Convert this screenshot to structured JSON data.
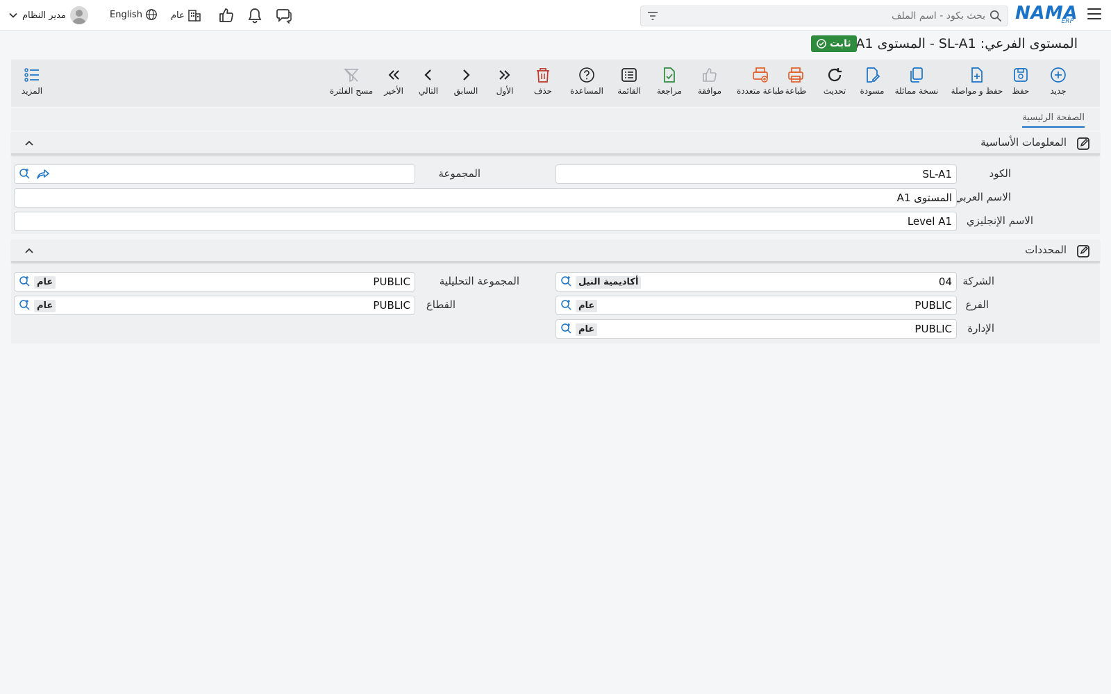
{
  "header": {
    "logo_text": "NAMA",
    "logo_sub": "ERP",
    "search_placeholder": "بحث بكود - اسم الملف",
    "language": "English",
    "branch": "عام",
    "user": "مدير النظام"
  },
  "page": {
    "title": "المستوى الفرعي: SL-A1 - المستوى A1",
    "status_badge": "ثابت"
  },
  "toolbar": {
    "new": "جديد",
    "save": "حفظ",
    "save_continue": "حفظ و مواصلة",
    "duplicate": "نسخة مماثلة",
    "draft": "مسودة",
    "refresh": "تحديث",
    "print": "طباعة",
    "multi_print": "طباعة متعددة",
    "approve": "موافقة",
    "review": "مراجعة",
    "list": "القائمة",
    "help": "المساعدة",
    "delete": "حذف",
    "first": "الأول",
    "previous": "السابق",
    "next": "التالي",
    "last": "الأخير",
    "clear_filter": "مسح الفلترة",
    "more": "المزيد"
  },
  "tabs": {
    "main": "الصفحة الرئيسية"
  },
  "basic_info": {
    "title": "المعلومات الأساسية",
    "code_label": "الكود",
    "code_value": "SL-A1",
    "group_label": "المجموعة",
    "group_value": "",
    "arabic_name_label": "الاسم العربي",
    "arabic_name_value": "المستوى A1",
    "english_name_label": "الاسم الإنجليزي",
    "english_name_value": "Level A1"
  },
  "dimensions": {
    "title": "المحددات",
    "company_label": "الشركة",
    "company_code": "04",
    "company_name": "أكاديمية النيل",
    "analytic_group_label": "المجموعة التحليلية",
    "analytic_group_code": "PUBLIC",
    "analytic_group_name": "عام",
    "branch_label": "الفرع",
    "branch_code": "PUBLIC",
    "branch_name": "عام",
    "sector_label": "القطاع",
    "sector_code": "PUBLIC",
    "sector_name": "عام",
    "department_label": "الإدارة",
    "department_code": "PUBLIC",
    "department_name": "عام"
  },
  "colors": {
    "brand": "#1a73c9",
    "success": "#2e8b3d",
    "danger": "#e0602a",
    "delete": "#c0392b",
    "green_action": "#2e8b3d"
  }
}
